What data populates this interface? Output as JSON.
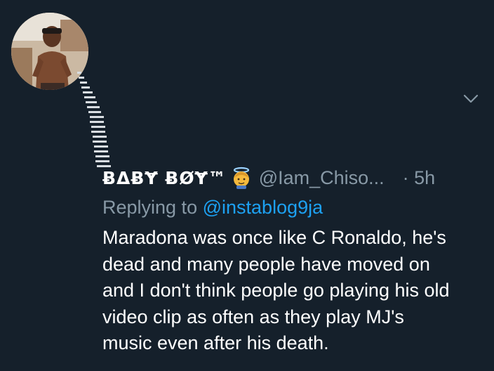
{
  "colors": {
    "background": "#15202b",
    "text": "#ffffff",
    "muted": "#8899a6",
    "link": "#1da1f2"
  },
  "tweet": {
    "avatar_icon": "profile-photo",
    "display_name": "ɃΔɃɎ ɃØɎ™",
    "badge_icon": "angel-emoji",
    "handle": "@Iam_Chiso...",
    "time": "· 5h",
    "replying_label": "Replying to",
    "replying_to": "@instablog9ja",
    "text_lines": [
      "Maradona was once like C Ronaldo, he's",
      "dead and many people have moved on",
      "and I don't think people go playing his old",
      "video clip as often as they play MJ's",
      "music even after his death."
    ],
    "menu_icon": "chevron-down-icon"
  }
}
